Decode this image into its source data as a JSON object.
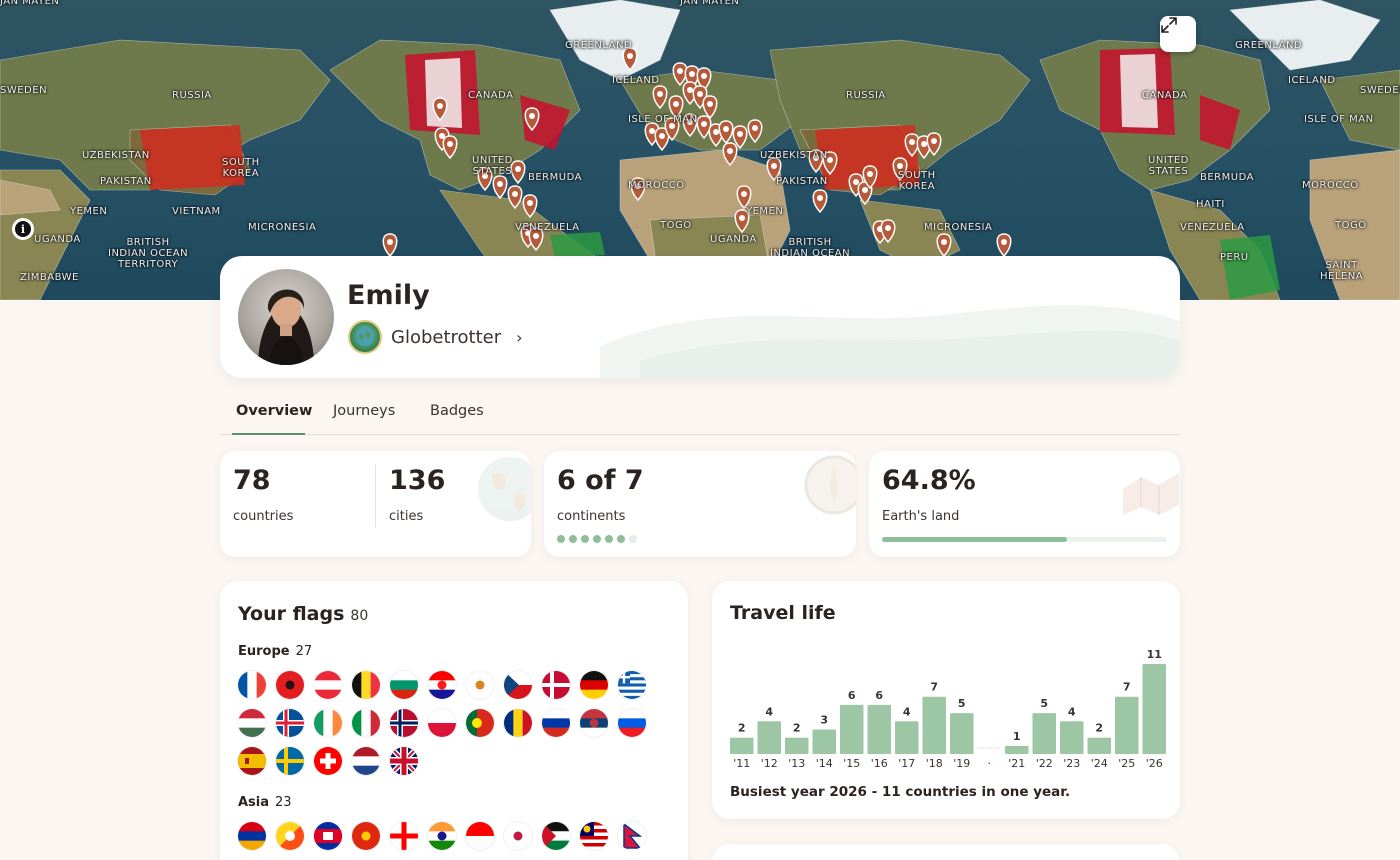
{
  "map": {
    "labels": [
      "JAN MAYEN",
      "JAN MAYEN",
      "GREENLAND",
      "GREENLAND",
      "ICELAND",
      "ICELAND",
      "RUSSIA",
      "RUSSIA",
      "CANADA",
      "CANADA",
      "SWEDEN",
      "SWEDEN",
      "UNITED STATES",
      "UNITED STATES",
      "UZBEKISTAN",
      "UZBEKISTAN",
      "PAKISTAN",
      "PAKISTAN",
      "SOUTH KOREA",
      "SOUTH KOREA",
      "BERMUDA",
      "BERMUDA",
      "MOROCCO",
      "MOROCCO",
      "YEMEN",
      "YEMEN",
      "VIETNAM",
      "HAITI",
      "MICRONESIA",
      "MICRONESIA",
      "VENEZUELA",
      "VENEZUELA",
      "TOGO",
      "TOGO",
      "UGANDA",
      "UGANDA",
      "BRITISH INDIAN OCEAN TERRITORY",
      "BRITISH INDIAN OCEAN",
      "ZIMBABWE",
      "PERU",
      "SAINT HELENA",
      "ISLE OF MAN",
      "ISLE OF MAN"
    ],
    "expand_icon": "expand-arrows-icon",
    "info_icon": "info-icon"
  },
  "profile": {
    "name": "Emily",
    "level": "Globetrotter",
    "level_icon": "globetrotter-badge-icon"
  },
  "tabs": [
    {
      "label": "Overview",
      "active": true
    },
    {
      "label": "Journeys",
      "active": false
    },
    {
      "label": "Badges",
      "active": false
    }
  ],
  "stats": {
    "countries": {
      "value": "78",
      "label": "countries"
    },
    "cities": {
      "value": "136",
      "label": "cities"
    },
    "continents": {
      "value": "6 of 7",
      "label": "continents",
      "visited": 6,
      "total": 7
    },
    "land": {
      "value": "64.8%",
      "label": "Earth's land",
      "fraction": 0.648
    }
  },
  "flags": {
    "title": "Your flags",
    "count": "80",
    "regions": [
      {
        "name": "Europe",
        "count": "27",
        "countries": [
          "France",
          "Albania",
          "Austria",
          "Belgium",
          "Bulgaria",
          "Croatia",
          "Cyprus",
          "Czechia",
          "Denmark",
          "Germany",
          "Greece",
          "Hungary",
          "Iceland",
          "Ireland",
          "Italy",
          "Norway",
          "Poland",
          "Portugal",
          "Romania",
          "Russia",
          "Serbia",
          "Slovenia",
          "Spain",
          "Sweden",
          "Switzerland",
          "Netherlands",
          "United Kingdom"
        ]
      },
      {
        "name": "Asia",
        "count": "23",
        "countries": [
          "Armenia",
          "Bhutan",
          "Cambodia",
          "China",
          "Georgia",
          "India",
          "Indonesia",
          "Japan",
          "Jordan",
          "Malaysia",
          "Nepal"
        ]
      }
    ]
  },
  "travel": {
    "title": "Travel life",
    "busiest": "Busiest year 2026 - 11 countries in one year."
  },
  "chart_data": {
    "type": "bar",
    "title": "Travel life",
    "categories": [
      "'11",
      "'12",
      "'13",
      "'14",
      "'15",
      "'16",
      "'17",
      "'18",
      "'19",
      "·",
      "'21",
      "'22",
      "'23",
      "'24",
      "'25",
      "'26"
    ],
    "values": [
      2,
      4,
      2,
      3,
      6,
      6,
      4,
      7,
      5,
      null,
      1,
      5,
      4,
      2,
      7,
      11
    ],
    "ylim": [
      0,
      11
    ],
    "color": "#9dc6a5",
    "highlight_color": "#8bbb94",
    "grid": false
  },
  "colors": {
    "accent": "#5a8f6a",
    "bar": "#9dc6a5",
    "background": "#fbf6f2"
  }
}
